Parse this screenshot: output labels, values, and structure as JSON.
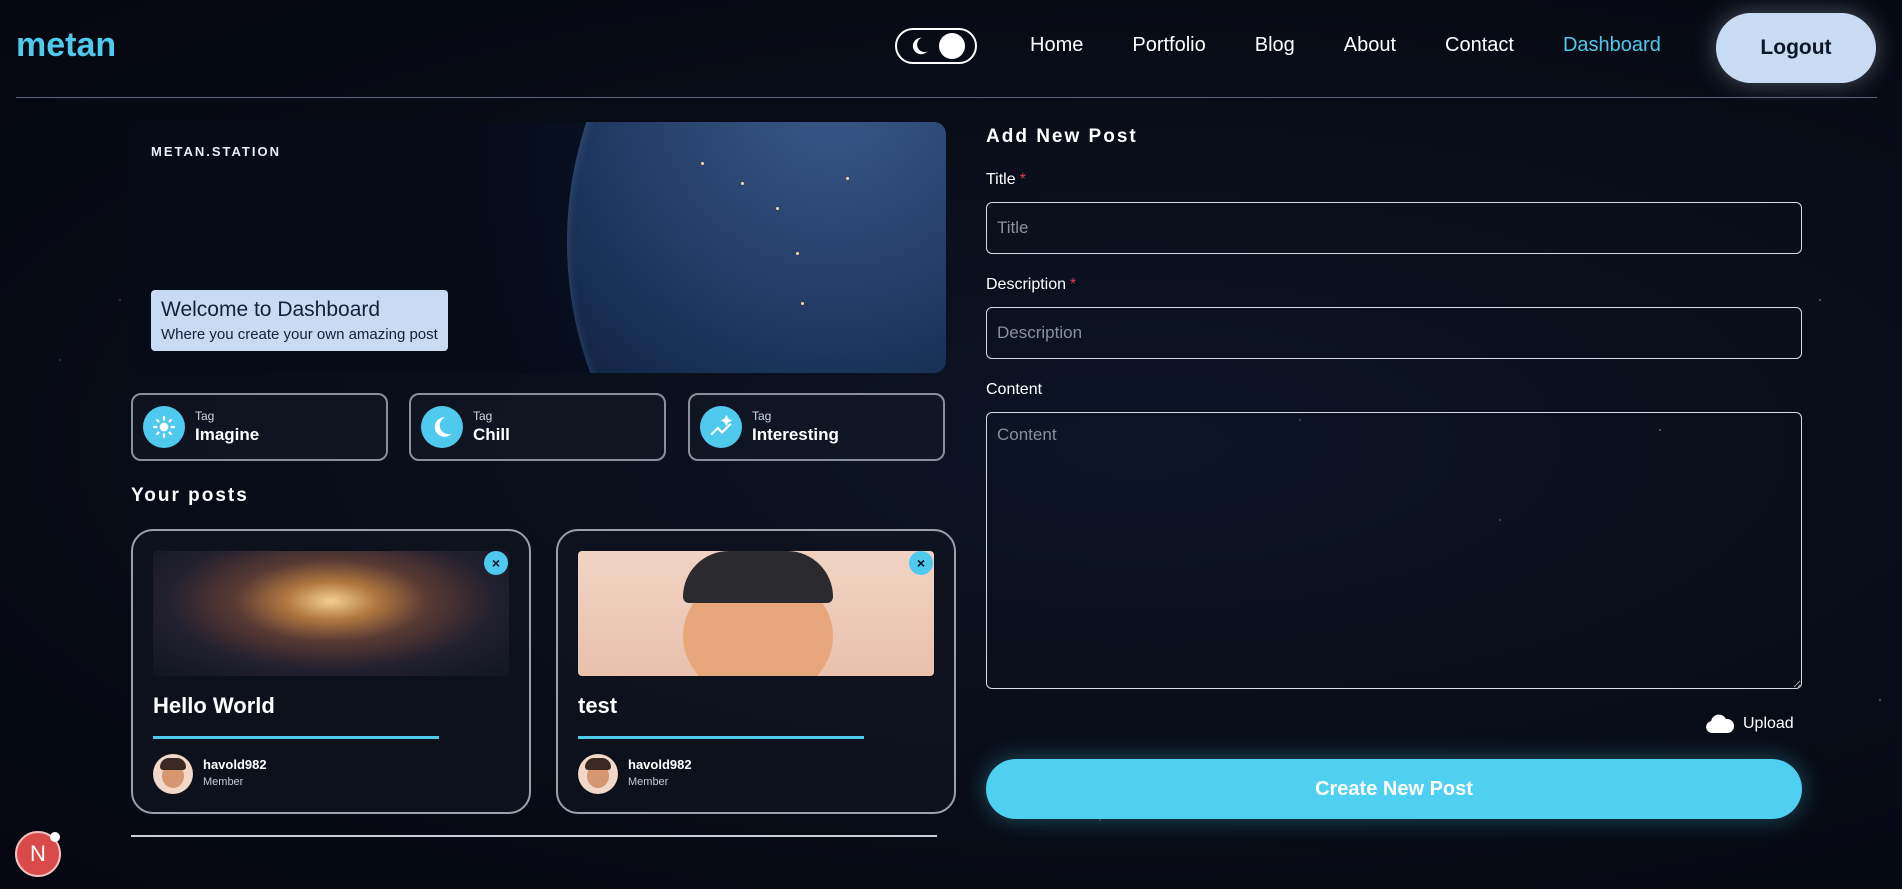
{
  "header": {
    "logo": "metan",
    "nav": [
      "Home",
      "Portfolio",
      "Blog",
      "About",
      "Contact",
      "Dashboard"
    ],
    "active_nav": "Dashboard",
    "logout_label": "Logout"
  },
  "banner": {
    "station_label": "METAN.STATION",
    "title": "Welcome to Dashboard",
    "subtitle": "Where you create your own amazing post"
  },
  "tags": [
    {
      "small": "Tag",
      "name": "Imagine",
      "icon": "sun-sparkle-icon"
    },
    {
      "small": "Tag",
      "name": "Chill",
      "icon": "moon-icon"
    },
    {
      "small": "Tag",
      "name": "Interesting",
      "icon": "trend-sparkle-icon"
    }
  ],
  "posts_heading": "Your posts",
  "posts": [
    {
      "title": "Hello World",
      "author": "havold982",
      "role": "Member",
      "close": "×"
    },
    {
      "title": "test",
      "author": "havold982",
      "role": "Member",
      "close": "×"
    }
  ],
  "form": {
    "heading": "Add New Post",
    "title_label": "Title",
    "title_placeholder": "Title",
    "description_label": "Description",
    "description_placeholder": "Description",
    "content_label": "Content",
    "content_placeholder": "Content",
    "required_mark": "*",
    "upload_label": "Upload",
    "submit_label": "Create New Post"
  },
  "badge": "N",
  "colors": {
    "accent": "#4fc9ee",
    "button_light": "#c8dbf2",
    "required": "#e0394f"
  }
}
